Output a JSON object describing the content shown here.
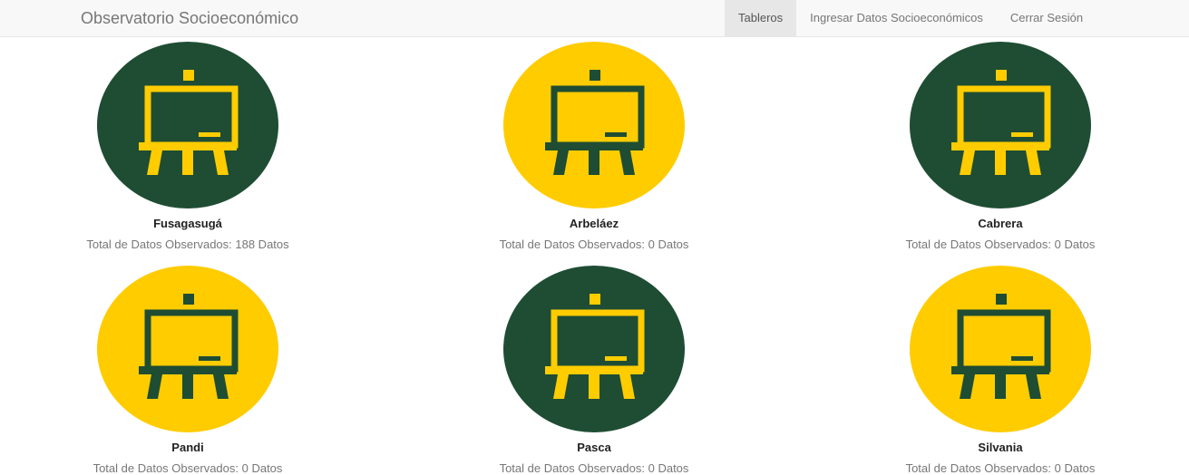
{
  "navbar": {
    "brand": "Observatorio Socioeconómico",
    "items": [
      {
        "label": "Tableros",
        "active": true
      },
      {
        "label": "Ingresar Datos Socioeconómicos",
        "active": false
      },
      {
        "label": "Cerrar Sesión",
        "active": false
      }
    ]
  },
  "colors": {
    "green": "#1e4d33",
    "yellow": "#ffcc00"
  },
  "icon": "easel-board-icon",
  "cards": [
    {
      "name": "Fusagasugá",
      "subtitle": "Total de Datos Observados: 188 Datos",
      "theme": "green"
    },
    {
      "name": "Arbeláez",
      "subtitle": "Total de Datos Observados: 0 Datos",
      "theme": "yellow"
    },
    {
      "name": "Cabrera",
      "subtitle": "Total de Datos Observados: 0 Datos",
      "theme": "green"
    },
    {
      "name": "Pandi",
      "subtitle": "Total de Datos Observados: 0 Datos",
      "theme": "yellow"
    },
    {
      "name": "Pasca",
      "subtitle": "Total de Datos Observados: 0 Datos",
      "theme": "green"
    },
    {
      "name": "Silvania",
      "subtitle": "Total de Datos Observados: 0 Datos",
      "theme": "yellow"
    }
  ]
}
